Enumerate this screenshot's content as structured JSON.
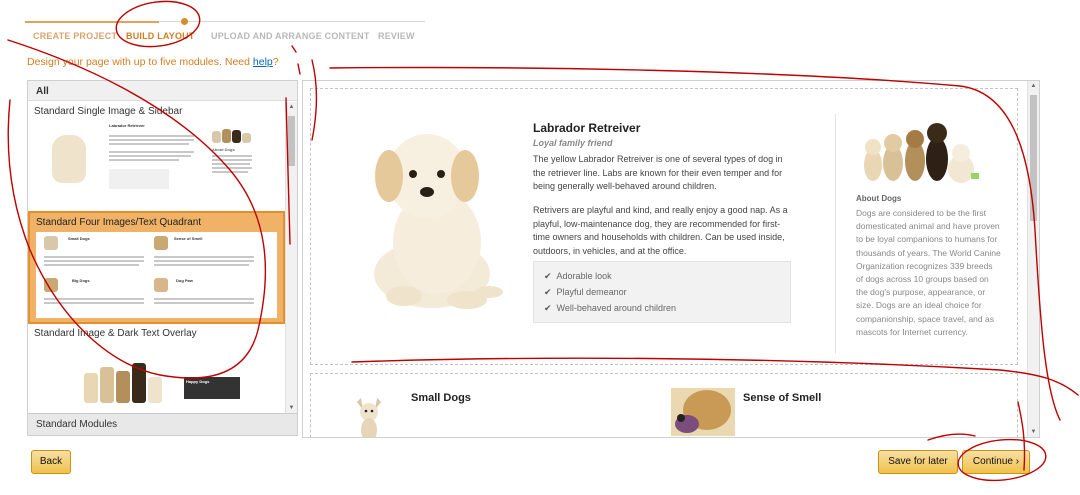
{
  "stepper": {
    "steps": [
      {
        "label": "CREATE PROJECT",
        "state": "done"
      },
      {
        "label": "BUILD LAYOUT",
        "state": "active"
      },
      {
        "label": "UPLOAD AND ARRANGE CONTENT",
        "state": "upcoming"
      },
      {
        "label": "REVIEW",
        "state": "upcoming"
      }
    ]
  },
  "intro": {
    "text": "Design your page with up to five modules. Need ",
    "help_link": "help",
    "suffix": "?"
  },
  "module_panel": {
    "filter_label": "All",
    "modules": [
      {
        "title": "Standard Single Image & Sidebar",
        "selected": false
      },
      {
        "title": "Standard Four Images/Text Quadrant",
        "selected": true
      },
      {
        "title": "Standard Image & Dark Text Overlay",
        "selected": false
      }
    ],
    "footer_label": "Standard Modules"
  },
  "preview": {
    "main": {
      "title": "Labrador Retreiver",
      "subtitle": "Loyal family friend",
      "paragraph1": "The yellow Labrador Retreiver is one of several types of dog in the retriever line. Labs are known for their even temper and for being generally well-behaved around children.",
      "paragraph2": "Retrivers are playful and kind, and really enjoy a good nap. As a playful, low-maintenance dog, they are recommended for first-time owners and households with children. Can be used inside, outdoors, in vehicles, and at the office.",
      "checklist": [
        "Adorable look",
        "Playful demeanor",
        "Well-behaved around children"
      ]
    },
    "sidebar": {
      "heading": "About Dogs",
      "text": "Dogs are considered to be the first domesticated animal and have proven to be loyal companions to humans for thousands of years. The World Canine Organization recognizes 339 breeds of dogs across 10 groups based on the dog's purpose, appearance, or size. Dogs are an ideal choice for companionship, space travel, and as mascots for Internet currency."
    },
    "quadrant": {
      "left_title": "Small Dogs",
      "right_title": "Sense of Smell"
    }
  },
  "thumbs": {
    "single": {
      "title": "Labrador Retriever",
      "sidebar_title": "About Dogs"
    },
    "quadrant": {
      "tl": "Small Dogs",
      "tr": "Sense of Smell",
      "bl": "Big Dogs",
      "br": "Dog Paw"
    },
    "overlay": {
      "title": "Happy Dogs"
    }
  },
  "buttons": {
    "back": "Back",
    "save": "Save for later",
    "continue": "Continue ›"
  },
  "colors": {
    "accent_orange": "#d27d22",
    "selected_module_bg": "#f0b267",
    "button_yellow": "#f0c14b",
    "annotation_red": "#c00000"
  }
}
